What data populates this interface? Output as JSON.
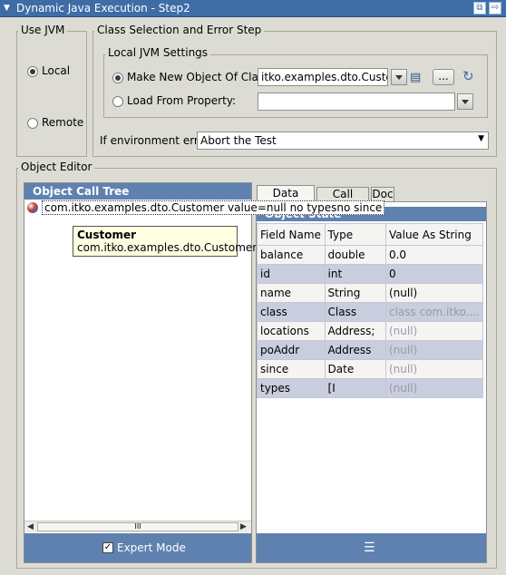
{
  "titlebar": {
    "title": "Dynamic Java Execution - Step2",
    "arrow": "▼"
  },
  "use_jvm": {
    "title": "Use JVM",
    "local_label": "Local",
    "remote_label": "Remote"
  },
  "class_selection": {
    "title": "Class Selection and Error Step",
    "local_jvm_title": "Local JVM Settings",
    "make_new_label": "Make New Object Of Class:",
    "class_value": "itko.examples.dto.Customer",
    "browse_label": "...",
    "load_from_label": "Load From Property:",
    "load_from_value": "",
    "env_error_label": "If environment error:",
    "env_error_value": "Abort the Test"
  },
  "object_editor": {
    "title": "Object Editor",
    "call_tree_title": "Object Call Tree",
    "tree_node": "com.itko.examples.dto.Customer value=null no typesno since",
    "tooltip_title": "Customer",
    "tooltip_class": "com.itko.examples.dto.Customer",
    "scroll_thumb": "III",
    "expert_mode_label": "Expert Mode",
    "tabs": [
      "Data Sheet",
      "Call Sheet",
      "Doc"
    ],
    "object_state_title": "Object State",
    "columns": [
      "Field Name",
      "Type",
      "Value As String"
    ],
    "rows": [
      [
        "balance",
        "double",
        "0.0"
      ],
      [
        "id",
        "int",
        "0"
      ],
      [
        "name",
        "String",
        "(null)"
      ],
      [
        "class",
        "Class",
        "class com.itko...."
      ],
      [
        "locations",
        "Address;",
        "(null)"
      ],
      [
        "poAddr",
        "Address",
        "(null)"
      ],
      [
        "since",
        "Date",
        "(null)"
      ],
      [
        "types",
        "[I",
        "(null)"
      ]
    ]
  },
  "colors": {
    "titlebar": "#3e6da6",
    "panel_header": "#5f81b0",
    "row_even": "#f6f3f3",
    "row_odd": "#c8cede"
  }
}
